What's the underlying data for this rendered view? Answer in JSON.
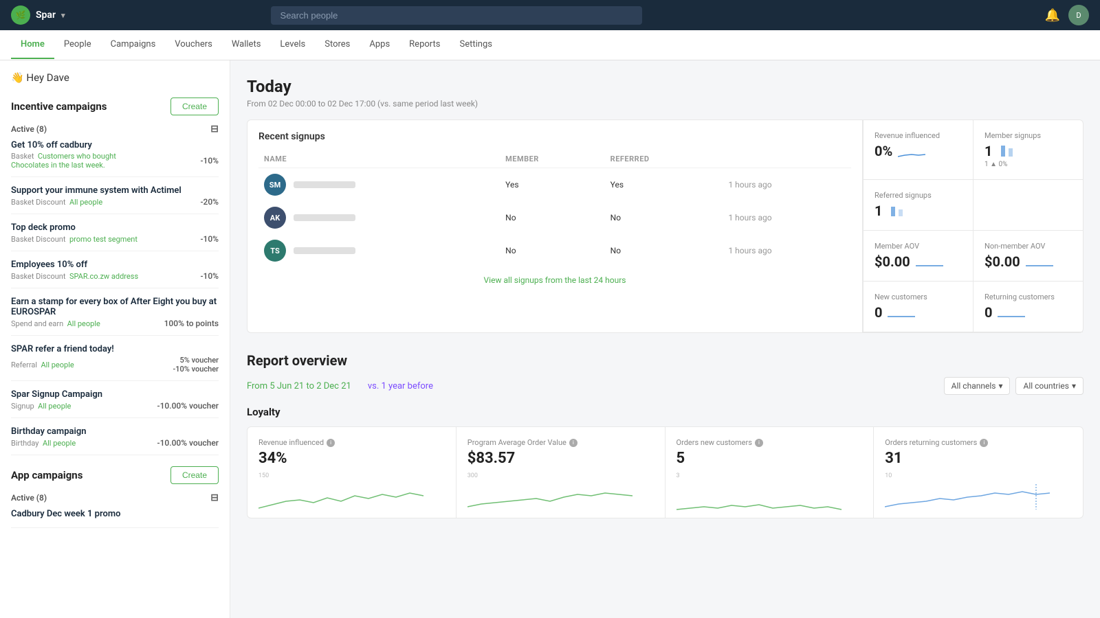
{
  "topNav": {
    "logoText": "Spar",
    "searchPlaceholder": "Search people",
    "chevron": "▾"
  },
  "mainNav": {
    "tabs": [
      {
        "label": "Home",
        "active": true
      },
      {
        "label": "People",
        "active": false
      },
      {
        "label": "Campaigns",
        "active": false
      },
      {
        "label": "Vouchers",
        "active": false
      },
      {
        "label": "Wallets",
        "active": false
      },
      {
        "label": "Levels",
        "active": false
      },
      {
        "label": "Stores",
        "active": false
      },
      {
        "label": "Apps",
        "active": false
      },
      {
        "label": "Reports",
        "active": false
      },
      {
        "label": "Settings",
        "active": false
      }
    ]
  },
  "sidebar": {
    "greeting": "👋 Hey Dave",
    "incentiveCampaigns": {
      "title": "Incentive campaigns",
      "createLabel": "Create",
      "activeLabel": "Active (8)",
      "campaigns": [
        {
          "name": "Get 10% off cadbury",
          "type": "Basket",
          "segment": "Customers who bought",
          "segmentSub": "Chocolates in the last week.",
          "discount": "-10%"
        },
        {
          "name": "Support your immune system with Actimel",
          "type": "Basket Discount",
          "segment": "All people",
          "segmentSub": "",
          "discount": "-20%"
        },
        {
          "name": "Top deck promo",
          "type": "Basket Discount",
          "segment": "promo test segment",
          "segmentSub": "",
          "discount": "-10%"
        },
        {
          "name": "Employees 10% off",
          "type": "Basket Discount",
          "segment": "SPAR.co.zw address",
          "segmentSub": "",
          "discount": "-10%"
        },
        {
          "name": "Earn a stamp for every box of After Eight you buy at EUROSPAR",
          "type": "Spend and earn",
          "segment": "All people",
          "segmentSub": "",
          "discount": "100% to points"
        },
        {
          "name": "SPAR refer a friend today!",
          "type": "Referral",
          "segment": "All people",
          "segmentSub": "",
          "discount1": "5% voucher",
          "discount2": "-10% voucher",
          "multi": true
        },
        {
          "name": "Spar Signup Campaign",
          "type": "Signup",
          "segment": "All people",
          "segmentSub": "",
          "discount": "-10.00% voucher"
        },
        {
          "name": "Birthday campaign",
          "type": "Birthday",
          "segment": "All people",
          "segmentSub": "",
          "discount": "-10.00% voucher"
        }
      ]
    },
    "appCampaigns": {
      "title": "App campaigns",
      "createLabel": "Create",
      "activeLabel": "Active (8)",
      "campaigns": [
        {
          "name": "Cadbury Dec week 1 promo",
          "type": "",
          "segment": "",
          "discount": ""
        }
      ]
    }
  },
  "today": {
    "title": "Today",
    "subtitle": "From 02 Dec 00:00 to 02 Dec 17:00 (vs. same period last week)",
    "signups": {
      "title": "Recent signups",
      "columns": [
        "NAME",
        "MEMBER",
        "REFERRED"
      ],
      "rows": [
        {
          "initials": "SM",
          "color": "#2d6a8a",
          "member": "Yes",
          "referred": "Yes",
          "time": "1 hours ago"
        },
        {
          "initials": "AK",
          "color": "#3d4f6e",
          "member": "No",
          "referred": "No",
          "time": "1 hours ago"
        },
        {
          "initials": "TS",
          "color": "#2d6a6a",
          "member": "No",
          "referred": "No",
          "time": "1 hours ago"
        }
      ],
      "viewAllLink": "View all signups from the last 24 hours"
    },
    "stats": [
      {
        "label": "Revenue influenced",
        "value": "0%",
        "trend": true
      },
      {
        "label": "Member signups",
        "value": "1",
        "trendText": "1 ▲ 0%"
      },
      {
        "label": "Referred signups",
        "value": "1",
        "trend": true
      },
      {
        "label": "Member AOV",
        "value": "$0.00",
        "trend": true
      },
      {
        "label": "Non-member AOV",
        "value": "$0.00",
        "trend": true
      },
      {
        "label": "",
        "value": "",
        "trend": false
      },
      {
        "label": "New customers",
        "value": "0",
        "trend": true
      },
      {
        "label": "Returning customers",
        "value": "0",
        "trend": true
      }
    ]
  },
  "reportOverview": {
    "title": "Report overview",
    "dateRange": "From 5 Jun 21 to 2 Dec 21",
    "vsLabel": "vs. 1 year before",
    "allChannels": "All channels",
    "allCountries": "All countries",
    "chevron": "▾",
    "loyalty": {
      "title": "Loyalty",
      "cards": [
        {
          "label": "Revenue influenced",
          "value": "34%",
          "hasInfo": true,
          "axisTop": "150"
        },
        {
          "label": "Program Average Order Value",
          "value": "$83.57",
          "hasInfo": true,
          "axisTop": "300"
        },
        {
          "label": "Orders new customers",
          "value": "5",
          "hasInfo": true,
          "axisTop": "3"
        },
        {
          "label": "Orders returning customers",
          "value": "31",
          "hasInfo": true,
          "axisTop": "10"
        }
      ]
    }
  }
}
